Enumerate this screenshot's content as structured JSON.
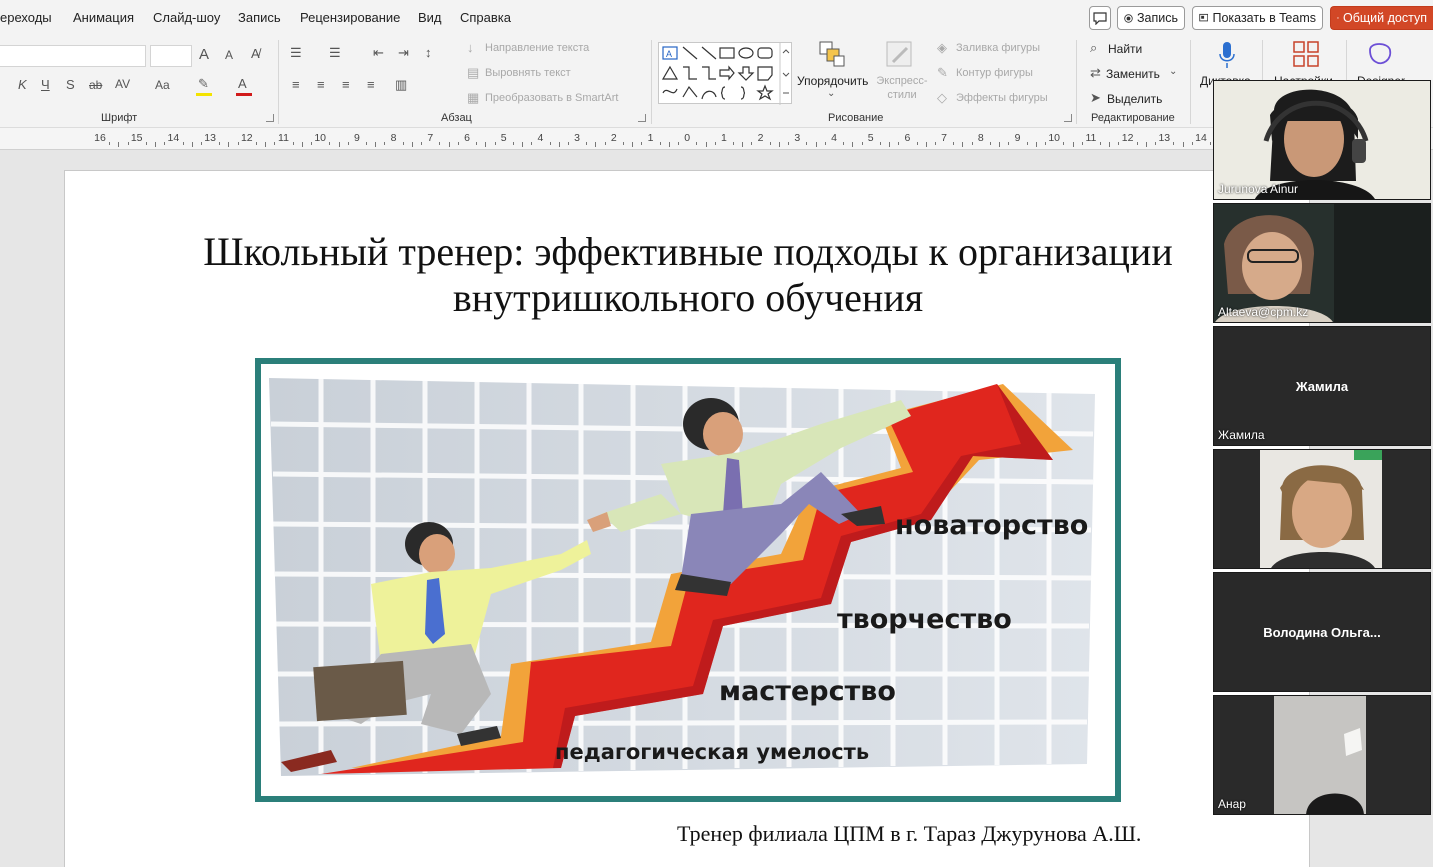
{
  "menu": {
    "items": [
      "ереходы",
      "Анимация",
      "Слайд-шоу",
      "Запись",
      "Рецензирование",
      "Вид",
      "Справка"
    ],
    "comment_icon": "comment-icon",
    "record_label": "Запись",
    "present_label": "Показать в Teams",
    "share_label": "Общий доступ"
  },
  "ribbon": {
    "font_group": {
      "label": "Шрифт",
      "grow": "A",
      "shrink": "A",
      "italic": "K",
      "underline": "Ч",
      "strike_s": "S",
      "strike_ab": "ab",
      "spacing": "AV",
      "case": "Aa",
      "highlight": "A"
    },
    "paragraph_group": {
      "label": "Абзац",
      "text_direction": "Направление текста",
      "align_text": "Выровнять текст",
      "convert_smartart": "Преобразовать в SmartArt"
    },
    "drawing_group": {
      "label": "Рисование",
      "arrange": "Упорядочить",
      "quick_styles": "Экспресс-стили",
      "fill": "Заливка фигуры",
      "outline": "Контур фигуры",
      "effects": "Эффекты фигуры"
    },
    "editing_group": {
      "label": "Редактирование",
      "find": "Найти",
      "replace": "Заменить",
      "select": "Выделить"
    },
    "voice": {
      "dictate": "Диктовка",
      "settings": "Настройки",
      "designer": "Designer"
    }
  },
  "ruler": {
    "labels": [
      "16",
      "15",
      "14",
      "13",
      "12",
      "11",
      "10",
      "9",
      "8",
      "7",
      "6",
      "5",
      "4",
      "3",
      "2",
      "1",
      "0",
      "1",
      "2",
      "3",
      "4",
      "5",
      "6",
      "7",
      "8",
      "9",
      "10",
      "11",
      "12",
      "13",
      "14"
    ]
  },
  "slide": {
    "title_line1": "Школьный тренер: эффективные подходы к организации",
    "title_line2": "внутришкольного обучения",
    "image_labels": {
      "step1": "педагогическая умелость",
      "step2": "мастерство",
      "step3": "творчество",
      "step4": "новаторство"
    },
    "footer": "Тренер филиала ЦПМ в г. Тараз Джурунова А.Ш."
  },
  "participants": [
    {
      "name": "Jurunova Ainur",
      "video": true
    },
    {
      "name": "Altaeva@cpm.kz",
      "video": true
    },
    {
      "name": "Жамила",
      "center_label": "Жамила",
      "video": false
    },
    {
      "name": "",
      "video": true
    },
    {
      "name": "",
      "center_label": "Володина  Ольга...",
      "video": false
    },
    {
      "name": "Анар",
      "video": true
    }
  ],
  "colors": {
    "share_button": "#d24726",
    "picture_frame": "#2b7f7a",
    "arrow_red": "#e0261e",
    "arrow_orange": "#f2a33a"
  }
}
